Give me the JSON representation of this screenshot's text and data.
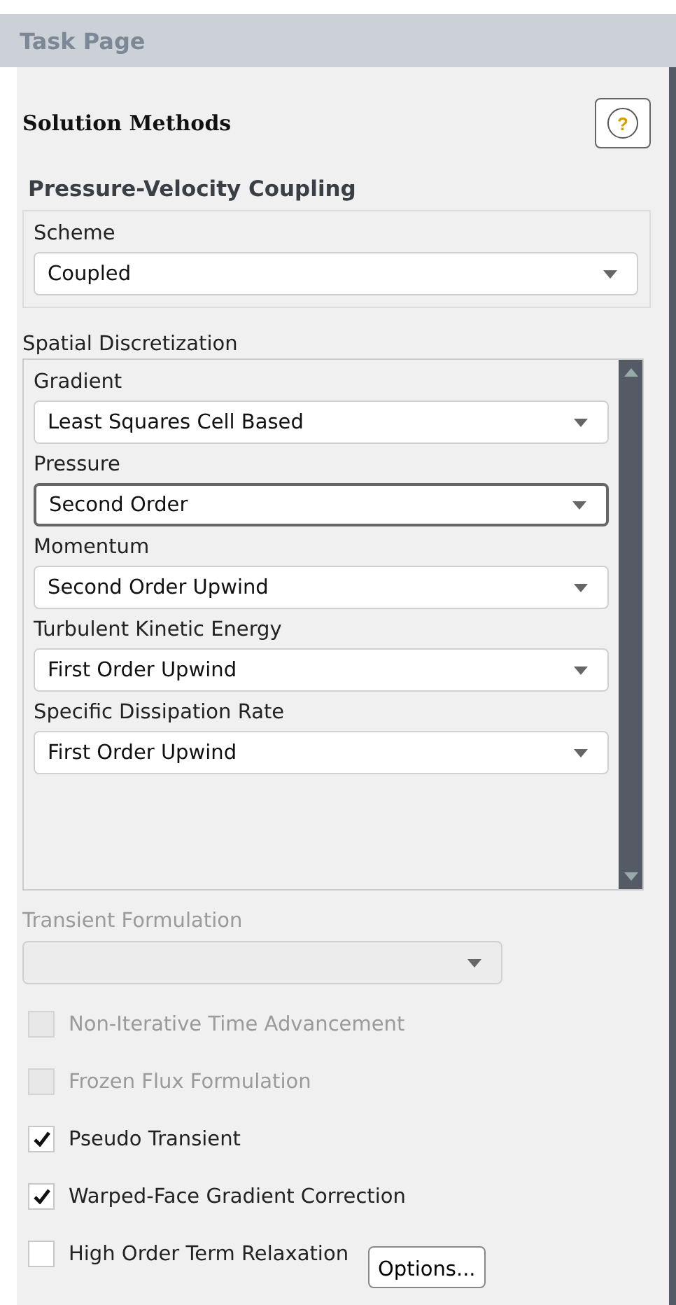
{
  "header": {
    "title": "Task Page"
  },
  "panel": {
    "title": "Solution Methods",
    "help_button": "?"
  },
  "coupling": {
    "title": "Pressure-Velocity Coupling",
    "field": {
      "label": "Scheme",
      "value": "Coupled",
      "focused": false
    }
  },
  "spatial": {
    "title": "Spatial Discretization",
    "fields": [
      {
        "label": "Gradient",
        "value": "Least Squares Cell Based",
        "focused": false
      },
      {
        "label": "Pressure",
        "value": "Second Order",
        "focused": true
      },
      {
        "label": "Momentum",
        "value": "Second Order Upwind",
        "focused": false
      },
      {
        "label": "Turbulent Kinetic Energy",
        "value": "First Order Upwind",
        "focused": false
      },
      {
        "label": "Specific Dissipation Rate",
        "value": "First Order Upwind",
        "focused": false
      }
    ]
  },
  "transient": {
    "label": "Transient Formulation",
    "disabled": true
  },
  "options": [
    {
      "label": "Non-Iterative Time Advancement",
      "checked": false,
      "disabled": true
    },
    {
      "label": "Frozen Flux Formulation",
      "checked": false,
      "disabled": true
    },
    {
      "label": "Pseudo Transient",
      "checked": true,
      "disabled": false
    },
    {
      "label": "Warped-Face Gradient Correction",
      "checked": true,
      "disabled": false
    },
    {
      "label": "High Order Term Relaxation",
      "checked": false,
      "disabled": false,
      "button": "Options..."
    }
  ]
}
